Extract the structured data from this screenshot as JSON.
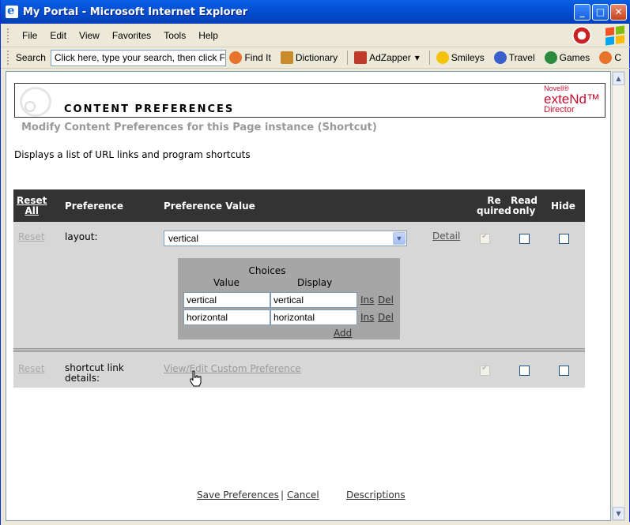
{
  "window": {
    "title": "My Portal - Microsoft Internet Explorer",
    "minimize": "_",
    "maximize": "□",
    "close": "✕"
  },
  "menubar": {
    "items": [
      "File",
      "Edit",
      "View",
      "Favorites",
      "Tools",
      "Help"
    ]
  },
  "toolbar": {
    "search_label": "Search",
    "search_placeholder": "Click here, type your search, then click Find It ->",
    "buttons": [
      {
        "label": "Find It",
        "icon": "find-it-icon",
        "color": "#e8732a"
      },
      {
        "label": "Dictionary",
        "icon": "dictionary-icon",
        "color": "#c98b2b"
      },
      {
        "label": "AdZapper",
        "icon": "adzapper-icon",
        "color": "#c0392b"
      },
      {
        "label": "Smileys",
        "icon": "smiley-icon",
        "color": "#f4c20d"
      },
      {
        "label": "Travel",
        "icon": "travel-icon",
        "color": "#3a5fcd"
      },
      {
        "label": "Games",
        "icon": "games-icon",
        "color": "#2b8a3e"
      },
      {
        "label": "C",
        "icon": "cursor-toolbar-icon",
        "color": "#e8732a"
      }
    ],
    "adzapper_dropdown": "▾"
  },
  "banner": {
    "title": "CONTENT PREFERENCES",
    "logo_line1": "Novell®",
    "logo_line2": "exteNd™",
    "logo_line3": "Director"
  },
  "subtitle": "Modify Content Preferences for this Page instance (Shortcut)",
  "description": "Displays a list of URL links and program shortcuts",
  "table": {
    "headers": {
      "reset_all_1": "Reset",
      "reset_all_2": "All",
      "preference": "Preference",
      "value": "Preference Value",
      "required_1": "Re",
      "required_2": "quired",
      "read_only_1": "Read",
      "read_only_2": "only",
      "hide": "Hide"
    },
    "rows": [
      {
        "reset": "Reset",
        "name": "layout:",
        "value": "vertical",
        "detail": "Detail",
        "required": true,
        "read_only": false,
        "hide": false
      },
      {
        "reset": "Reset",
        "name_1": "shortcut link",
        "name_2": "details:",
        "value_link": "View/Edit Custom Preference",
        "required": true,
        "read_only": false,
        "hide": false
      }
    ],
    "choices": {
      "title": "Choices",
      "value_header": "Value",
      "display_header": "Display",
      "items": [
        {
          "value": "vertical",
          "display": "vertical",
          "ins": "Ins",
          "del": "Del"
        },
        {
          "value": "horizontal",
          "display": "horizontal",
          "ins": "Ins",
          "del": "Del"
        }
      ],
      "add": "Add"
    }
  },
  "footer": {
    "save": "Save Preferences",
    "separator": "|",
    "cancel": "Cancel",
    "descriptions": "Descriptions"
  }
}
